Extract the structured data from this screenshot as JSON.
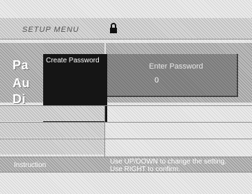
{
  "header": {
    "title": "SETUP MENU",
    "icon": "lock-icon"
  },
  "menu_items": [
    "Pa",
    "Au",
    "Di"
  ],
  "popup": {
    "label": "Create Password",
    "prompt": "Enter Password",
    "input_value": "0"
  },
  "instruction": {
    "label": "Instruction",
    "lines": [
      "Use UP/DOWN to change the setting.",
      "Use RIGHT to confirm."
    ]
  }
}
